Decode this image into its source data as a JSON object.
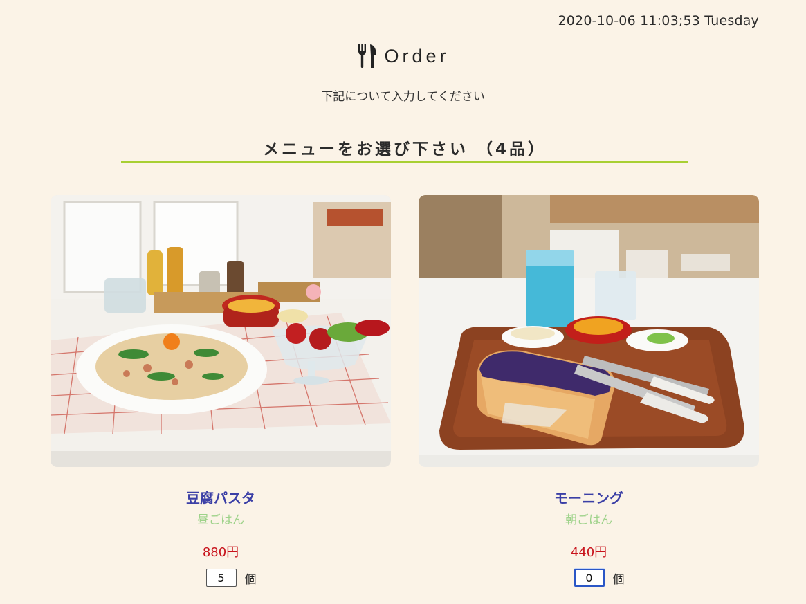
{
  "header": {
    "datetime": "2020-10-06 11:03;53 Tuesday",
    "logo_text": "Order",
    "subtitle": "下記について入力してください"
  },
  "section": {
    "title": "メニューをお選び下さい （4品）"
  },
  "menu_items": [
    {
      "name": "豆腐パスタ",
      "category": "昼ごはん",
      "price": "880円",
      "quantity": "5",
      "unit": "個",
      "photo": "pasta-lunch-photo"
    },
    {
      "name": "モーニング",
      "category": "朝ごはん",
      "price": "440円",
      "quantity": "0",
      "unit": "個",
      "photo": "toast-breakfast-photo"
    }
  ],
  "colors": {
    "background": "#fbf3e7",
    "accent_rule": "#a8cf33",
    "item_name": "#3b3fa6",
    "category": "#9ed28a",
    "price": "#c8121b",
    "focus": "#2a56c6"
  }
}
